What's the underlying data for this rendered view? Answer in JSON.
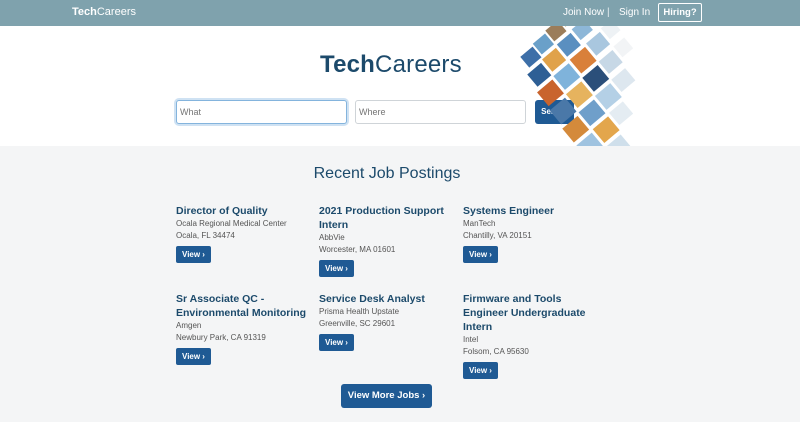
{
  "nav": {
    "logo_bold": "Tech",
    "logo_rest": "Careers",
    "join_label": "Join Now",
    "separator": "|",
    "signin_label": "Sign In",
    "hiring_label": "Hiring?"
  },
  "hero": {
    "title_bold": "Tech",
    "title_rest": "Careers",
    "what_placeholder": "What",
    "where_placeholder": "Where",
    "search_label": "Search"
  },
  "section": {
    "title": "Recent Job Postings"
  },
  "jobs": [
    {
      "title": "Director of Quality",
      "company": "Ocala Regional Medical Center",
      "location": "Ocala, FL 34474",
      "view": "View ›"
    },
    {
      "title": "2021 Production Support Intern",
      "company": "AbbVie",
      "location": "Worcester, MA 01601",
      "view": "View ›"
    },
    {
      "title": "Systems Engineer",
      "company": "ManTech",
      "location": "Chantilly, VA 20151",
      "view": "View ›"
    },
    {
      "title": "Sr Associate QC - Environmental Monitoring",
      "company": "Amgen",
      "location": "Newbury Park, CA 91319",
      "view": "View ›"
    },
    {
      "title": "Service Desk Analyst",
      "company": "Prisma Health Upstate",
      "location": "Greenville, SC 29601",
      "view": "View ›"
    },
    {
      "title": "Firmware and Tools Engineer Undergraduate Intern",
      "company": "Intel",
      "location": "Folsom, CA 95630",
      "view": "View ›"
    }
  ],
  "more_label": "View More Jobs ›",
  "colors": {
    "nav_bg": "#7fa2ad",
    "brand_dark": "#1c4a6b",
    "button": "#1f5a94"
  }
}
